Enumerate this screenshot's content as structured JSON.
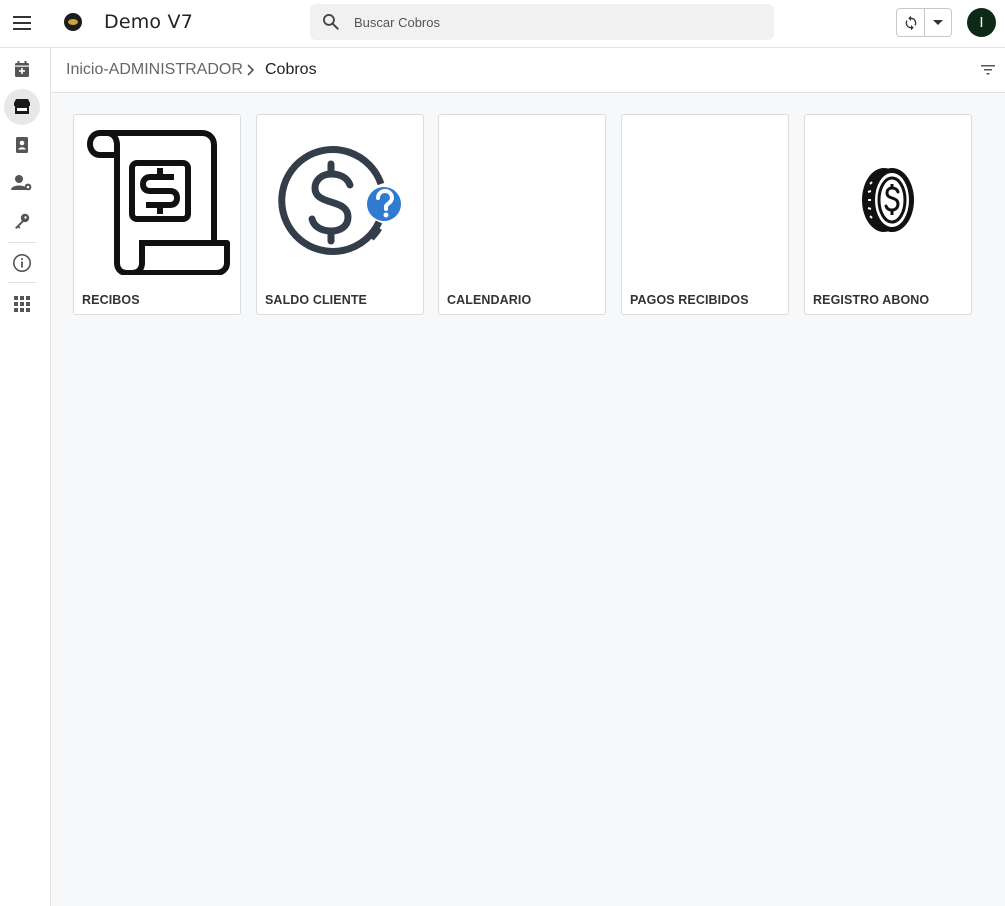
{
  "header": {
    "app_title": "Demo V7",
    "search_placeholder": "Buscar Cobros",
    "avatar_initial": "I"
  },
  "sidebar": {
    "items": [
      {
        "icon": "calendar-add-icon"
      },
      {
        "icon": "store-icon",
        "active": true
      },
      {
        "icon": "contact-book-icon"
      },
      {
        "icon": "user-settings-icon"
      },
      {
        "icon": "key-icon"
      },
      {
        "icon": "info-icon"
      },
      {
        "icon": "apps-grid-icon"
      }
    ]
  },
  "breadcrumb": {
    "home": "Inicio-ADMINISTRADOR",
    "current": "Cobros"
  },
  "cards": [
    {
      "label": "RECIBOS",
      "icon": "receipt-dollar-icon"
    },
    {
      "label": "SALDO CLIENTE",
      "icon": "dollar-question-icon"
    },
    {
      "label": "CALENDARIO",
      "icon": ""
    },
    {
      "label": "PAGOS RECIBIDOS",
      "icon": ""
    },
    {
      "label": "REGISTRO ABONO",
      "icon": "coin-dollar-icon"
    }
  ],
  "colors": {
    "background": "#f7f8fa",
    "avatar": "#0d2a16",
    "question_badge": "#2f7bd0",
    "dollar_ring": "#343d4a"
  }
}
